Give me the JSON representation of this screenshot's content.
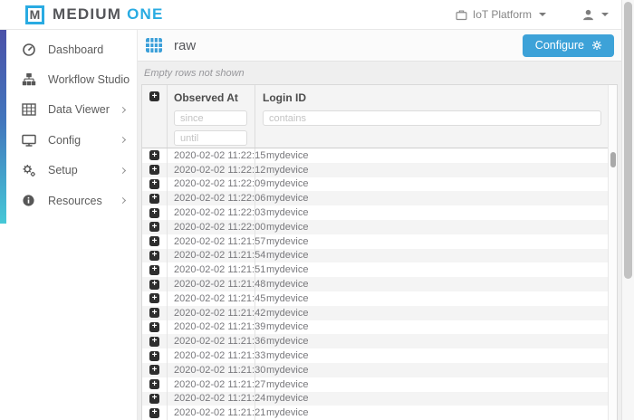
{
  "brand": {
    "logo_letter": "M",
    "name_primary": "MEDIUM",
    "name_accent": "ONE"
  },
  "topbar": {
    "platform_label": "IoT Platform"
  },
  "sidebar": {
    "items": [
      {
        "label": "Dashboard",
        "icon": "dashboard-icon",
        "has_submenu": false
      },
      {
        "label": "Workflow Studio",
        "icon": "workflow-icon",
        "has_submenu": false
      },
      {
        "label": "Data Viewer",
        "icon": "data-viewer-icon",
        "has_submenu": true
      },
      {
        "label": "Config",
        "icon": "config-icon",
        "has_submenu": true
      },
      {
        "label": "Setup",
        "icon": "setup-icon",
        "has_submenu": true
      },
      {
        "label": "Resources",
        "icon": "resources-icon",
        "has_submenu": true
      }
    ]
  },
  "content": {
    "title": "raw",
    "title_icon": "table-icon",
    "configure_label": "Configure",
    "configure_icon": "gear-icon",
    "empty_note": "Empty rows not shown",
    "table": {
      "expand_icon": "plus-square-icon",
      "columns": [
        {
          "label": "Observed At"
        },
        {
          "label": "Login ID"
        }
      ],
      "filters": {
        "since": "since",
        "until": "until",
        "contains": "contains"
      },
      "rows": [
        {
          "observed_at": "2020-02-02 11:22:15",
          "login_id": "mydevice"
        },
        {
          "observed_at": "2020-02-02 11:22:12",
          "login_id": "mydevice"
        },
        {
          "observed_at": "2020-02-02 11:22:09",
          "login_id": "mydevice"
        },
        {
          "observed_at": "2020-02-02 11:22:06",
          "login_id": "mydevice"
        },
        {
          "observed_at": "2020-02-02 11:22:03",
          "login_id": "mydevice"
        },
        {
          "observed_at": "2020-02-02 11:22:00",
          "login_id": "mydevice"
        },
        {
          "observed_at": "2020-02-02 11:21:57",
          "login_id": "mydevice"
        },
        {
          "observed_at": "2020-02-02 11:21:54",
          "login_id": "mydevice"
        },
        {
          "observed_at": "2020-02-02 11:21:51",
          "login_id": "mydevice"
        },
        {
          "observed_at": "2020-02-02 11:21:48",
          "login_id": "mydevice"
        },
        {
          "observed_at": "2020-02-02 11:21:45",
          "login_id": "mydevice"
        },
        {
          "observed_at": "2020-02-02 11:21:42",
          "login_id": "mydevice"
        },
        {
          "observed_at": "2020-02-02 11:21:39",
          "login_id": "mydevice"
        },
        {
          "observed_at": "2020-02-02 11:21:36",
          "login_id": "mydevice"
        },
        {
          "observed_at": "2020-02-02 11:21:33",
          "login_id": "mydevice"
        },
        {
          "observed_at": "2020-02-02 11:21:30",
          "login_id": "mydevice"
        },
        {
          "observed_at": "2020-02-02 11:21:27",
          "login_id": "mydevice"
        },
        {
          "observed_at": "2020-02-02 11:21:24",
          "login_id": "mydevice"
        },
        {
          "observed_at": "2020-02-02 11:21:21",
          "login_id": "mydevice"
        }
      ]
    }
  },
  "colors": {
    "accent_cyan": "#29abe2",
    "configure_button": "#3da2d8",
    "sidebar_gradient_top": "#4b51a8",
    "sidebar_gradient_bottom": "#46c8d7",
    "expand_button": "#2e2e2e"
  }
}
